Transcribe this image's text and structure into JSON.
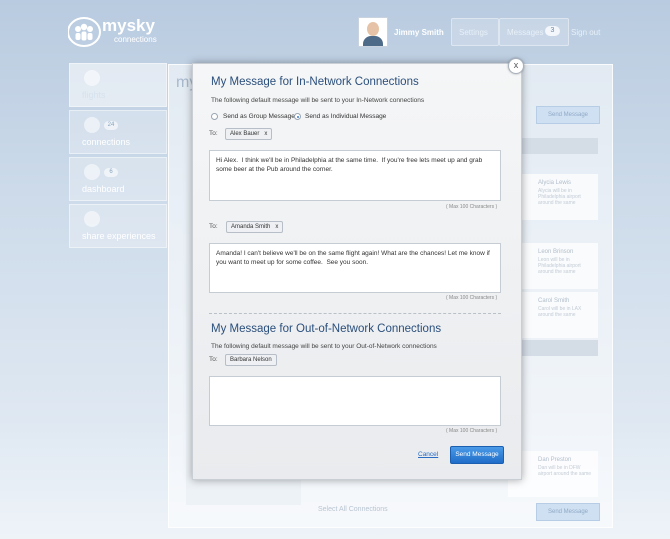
{
  "app": {
    "brand": "mysky",
    "brand_sub": "connections"
  },
  "header": {
    "user_name": "Jimmy Smith",
    "settings": "Settings",
    "messages": "Messages",
    "messages_count": "3",
    "sign_out": "Sign out"
  },
  "nav": {
    "items": [
      {
        "label": "flights",
        "icon": "airplane-icon"
      },
      {
        "label": "connections",
        "icon": "people-icon",
        "count": "24"
      },
      {
        "label": "dashboard",
        "icon": "dashboard-icon",
        "count": "6"
      },
      {
        "label": "share experiences",
        "icon": "share-icon"
      }
    ]
  },
  "background": {
    "title": "my",
    "send_message": "Send Message",
    "select_all": "Select All Connections",
    "cards": [
      {
        "name": "Alycia Lewis",
        "text": "Alycia will be in Philadelphia airport around the same"
      },
      {
        "name": "Leon Brinson",
        "text": "Leon will be in Philadelphia airport around the same"
      },
      {
        "name": "Carol Smith",
        "text": "Carol will be in LAX around the same"
      },
      {
        "name": "Dan Preston",
        "text": "Dan will be in DFW airport around the same"
      }
    ]
  },
  "modal": {
    "close": "x",
    "in_network": {
      "title": "My Message for In-Network Connections",
      "subtitle": "The following default message will be sent to your In-Network connections",
      "option_group": "Send as Group Message",
      "option_individual": "Send as Individual Message",
      "to_label": "To:",
      "messages": [
        {
          "recipient": "Alex Bauer",
          "text": "Hi Alex.  I think we'll be in Philadelphia at the same time.  If you're free lets meet up and grab\nsome beer at the Pub around the corner.",
          "max": "( Max 100 Characters )"
        },
        {
          "recipient": "Amanda Smith",
          "text": "Amanda! I can't believe we'll be on the same flight again! What are the chances! Let me know if\nyou want to meet up for some coffee.  See you soon.",
          "max": "( Max 100 Characters )"
        }
      ]
    },
    "out_network": {
      "title": "My Message for Out-of-Network Connections",
      "subtitle": "The following default message will be sent to your Out-of-Network connections",
      "to_label": "To:",
      "recipient": "Barbara Nelson",
      "text": "",
      "max": "( Max 100 Characters )"
    },
    "cancel": "Cancel",
    "send": "Send Message"
  }
}
